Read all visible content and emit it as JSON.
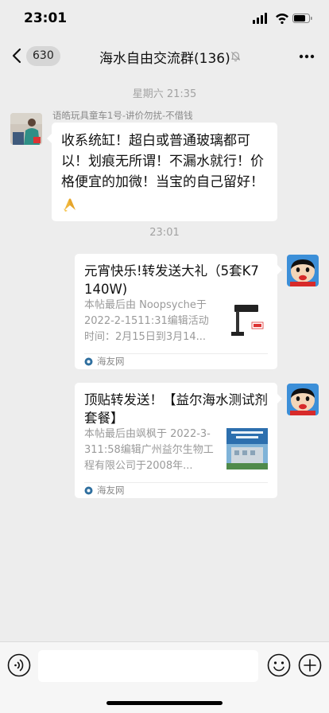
{
  "status_bar": {
    "time": "23:01"
  },
  "header": {
    "unread_count": "630",
    "title": "海水自由交流群(136)"
  },
  "messages": {
    "timestamp_1": "星期六 21:35",
    "sender_name": "语皓玩具童车1号-讲价勿扰-不借钱",
    "text_message": "收系统缸！超白或普通玻璃都可以！划痕无所谓！不漏水就行！价格便宜的加微！当宝的自己留好！",
    "timestamp_2": "23:01",
    "card_1": {
      "title": "元宵快乐!转发送大礼（5套K7 140W)",
      "description": "本帖最后由 Noopsyche于 2022-2-1511:31编辑活动时间：2月15日到3月14...",
      "source": "海友网"
    },
    "card_2": {
      "title": "顶贴转发送！【益尔海水测试剂套餐】",
      "description": "本帖最后由飒枫于 2022-3-311:58编辑广州益尔生物工程有限公司于2008年...",
      "source": "海友网"
    }
  },
  "icons": {
    "back": "chevron-left-icon",
    "mute": "bell-off-icon",
    "more": "more-icon",
    "voice": "voice-icon",
    "emoji": "emoji-icon",
    "plus": "plus-icon"
  },
  "colors": {
    "background": "#ededed",
    "bubble": "#ffffff",
    "timestamp": "#a2a2a2",
    "secondary_text": "#9a9a9a"
  }
}
